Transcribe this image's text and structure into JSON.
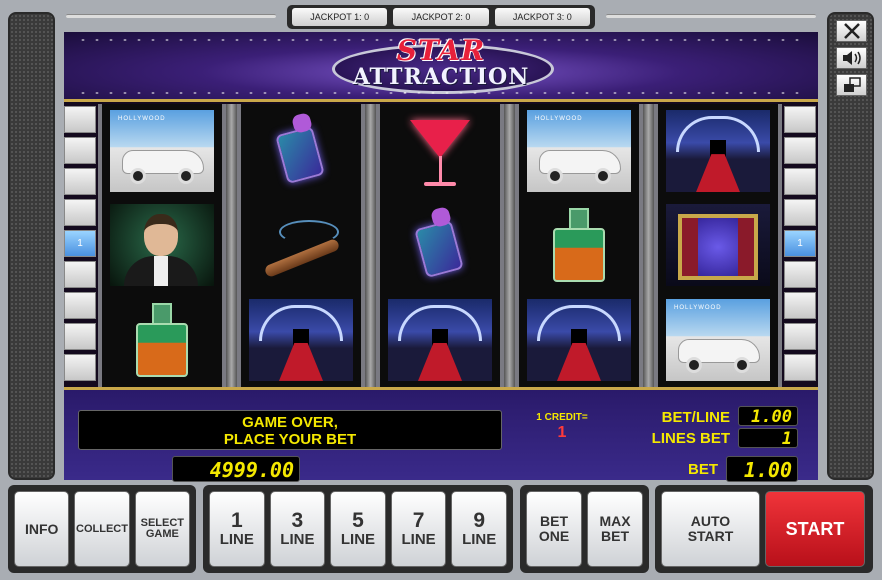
{
  "jackpots": [
    "JACKPOT 1: 0",
    "JACKPOT 2: 0",
    "JACKPOT 3: 0"
  ],
  "logo": {
    "line1": "STAR",
    "line2": "ATTRACTION"
  },
  "line_markers": {
    "left": "1",
    "right": "1"
  },
  "reels": [
    [
      "car",
      "actor",
      "decanter"
    ],
    [
      "perfume",
      "cigar",
      "carpet"
    ],
    [
      "martini",
      "perfume",
      "carpet"
    ],
    [
      "car",
      "decanter",
      "carpet"
    ],
    [
      "carpet",
      "theater",
      "car"
    ]
  ],
  "info": {
    "message_line1": "GAME OVER,",
    "message_line2": "PLACE YOUR BET",
    "credit_label": "1 CREDIT=",
    "credit_value": "1",
    "bet_line_label": "BET/LINE",
    "bet_line_value": "1.00",
    "lines_bet_label": "LINES BET",
    "lines_bet_value": "1",
    "bet_label": "BET",
    "bet_value": "1.00",
    "balance": "4999.00"
  },
  "buttons": {
    "info": "INFO",
    "collect": "COLLECT",
    "select_game": [
      "SELECT",
      "GAME"
    ],
    "lines": [
      {
        "num": "1",
        "label": "LINE"
      },
      {
        "num": "3",
        "label": "LINE"
      },
      {
        "num": "5",
        "label": "LINE"
      },
      {
        "num": "7",
        "label": "LINE"
      },
      {
        "num": "9",
        "label": "LINE"
      }
    ],
    "bet_one": [
      "BET",
      "ONE"
    ],
    "max_bet": [
      "MAX",
      "BET"
    ],
    "auto_start": [
      "AUTO",
      "START"
    ],
    "start": "START"
  },
  "colors": {
    "accent_yellow": "#f4e800",
    "start_red": "#d8202a",
    "panel_purple": "#3a2a8a"
  }
}
